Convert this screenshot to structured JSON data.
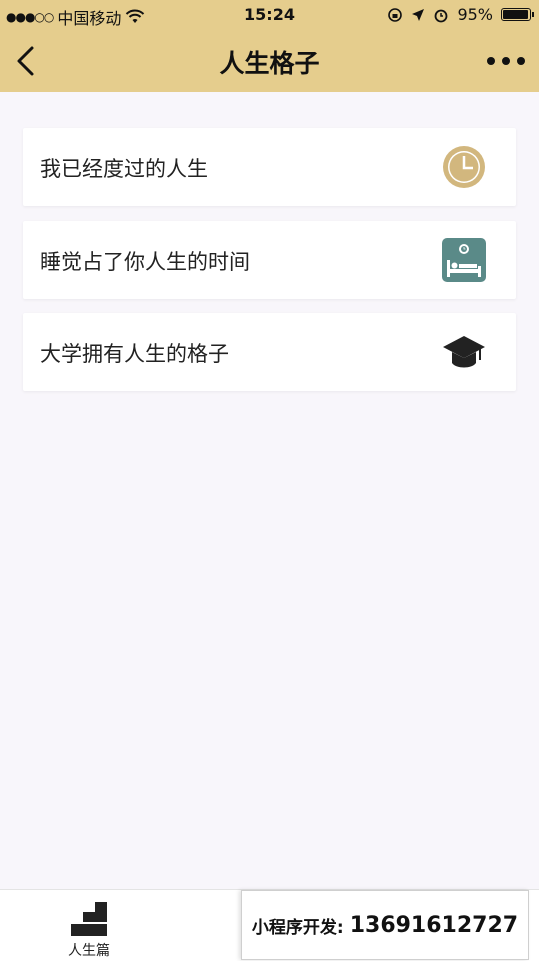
{
  "status_bar": {
    "signal": "●●●○○",
    "carrier": "中国移动",
    "time": "15:24",
    "battery_text": "95%",
    "battery_level": 0.95
  },
  "nav": {
    "title": "人生格子"
  },
  "cards": [
    {
      "label": "我已经度过的人生",
      "icon": "clock-icon",
      "icon_color": "#d2b77e"
    },
    {
      "label": "睡觉占了你人生的时间",
      "icon": "bed-icon",
      "icon_color": "#5a8a88"
    },
    {
      "label": "大学拥有人生的格子",
      "icon": "graduation-cap-icon",
      "icon_color": "#222222"
    }
  ],
  "tabbar": {
    "tabs": [
      {
        "label": "人生篇",
        "icon": "stairs-icon"
      }
    ]
  },
  "promo": {
    "text": "小程序开发:",
    "phone": "13691612727"
  },
  "colors": {
    "header": "#e5cd8d",
    "page_bg": "#f8f6fb"
  }
}
